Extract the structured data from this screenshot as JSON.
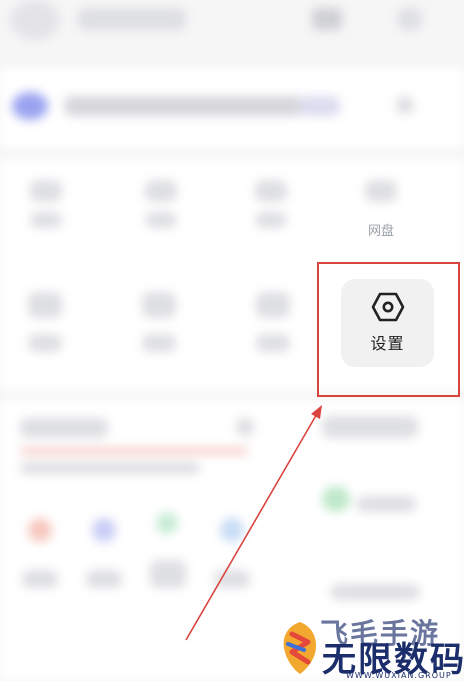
{
  "settings_tile": {
    "label": "设置",
    "icon": "hexagon-settings-icon"
  },
  "background": {
    "visible_label": "网盘"
  },
  "watermark": {
    "top_text": "飞毛手游",
    "main_text": "无限数码",
    "sub_text": "WWW.WUXIAN.GROUP"
  },
  "colors": {
    "highlight": "#d9453e",
    "watermark_text": "#1b2d6b"
  }
}
